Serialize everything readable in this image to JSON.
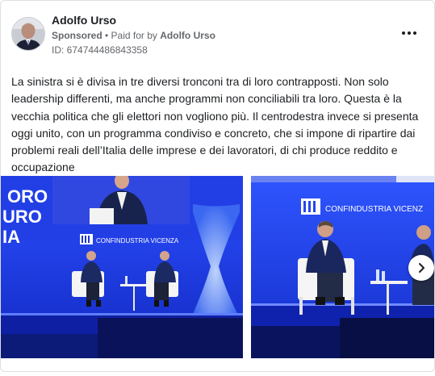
{
  "post": {
    "author": "Adolfo Urso",
    "sponsored": "Sponsored",
    "separator": " • ",
    "paid_for_prefix": "Paid for by ",
    "paid_for_name": "Adolfo Urso",
    "ad_id": "ID: 674744486843358",
    "text": "La sinistra si è divisa in tre diversi tronconi tra di loro contrapposti. Non solo leadership differenti, ma anche programmi non conciliabili tra loro. Questa è la vecchia politica che gli elettori non vogliono più. Il centrodestra invece si presenta oggi unito, con un programma condiviso e concreto, che si impone di ripartire dai problemi reali dell’Italia delle imprese e dei lavoratori, di chi produce reddito e occupazione"
  },
  "photo1": {
    "screen_text": [
      "ORO",
      "URO",
      "IA"
    ],
    "logo_text": "CONFINDUSTRIA VICENZA"
  },
  "photo2": {
    "logo_text": "CONFINDUSTRIA VICENZ"
  },
  "icons": {
    "more": "more-horizontal-icon",
    "next": "chevron-right-icon"
  },
  "colors": {
    "stage_blue": "#1d3bd8",
    "text_primary": "#1c1e21",
    "text_secondary": "#65676b"
  }
}
